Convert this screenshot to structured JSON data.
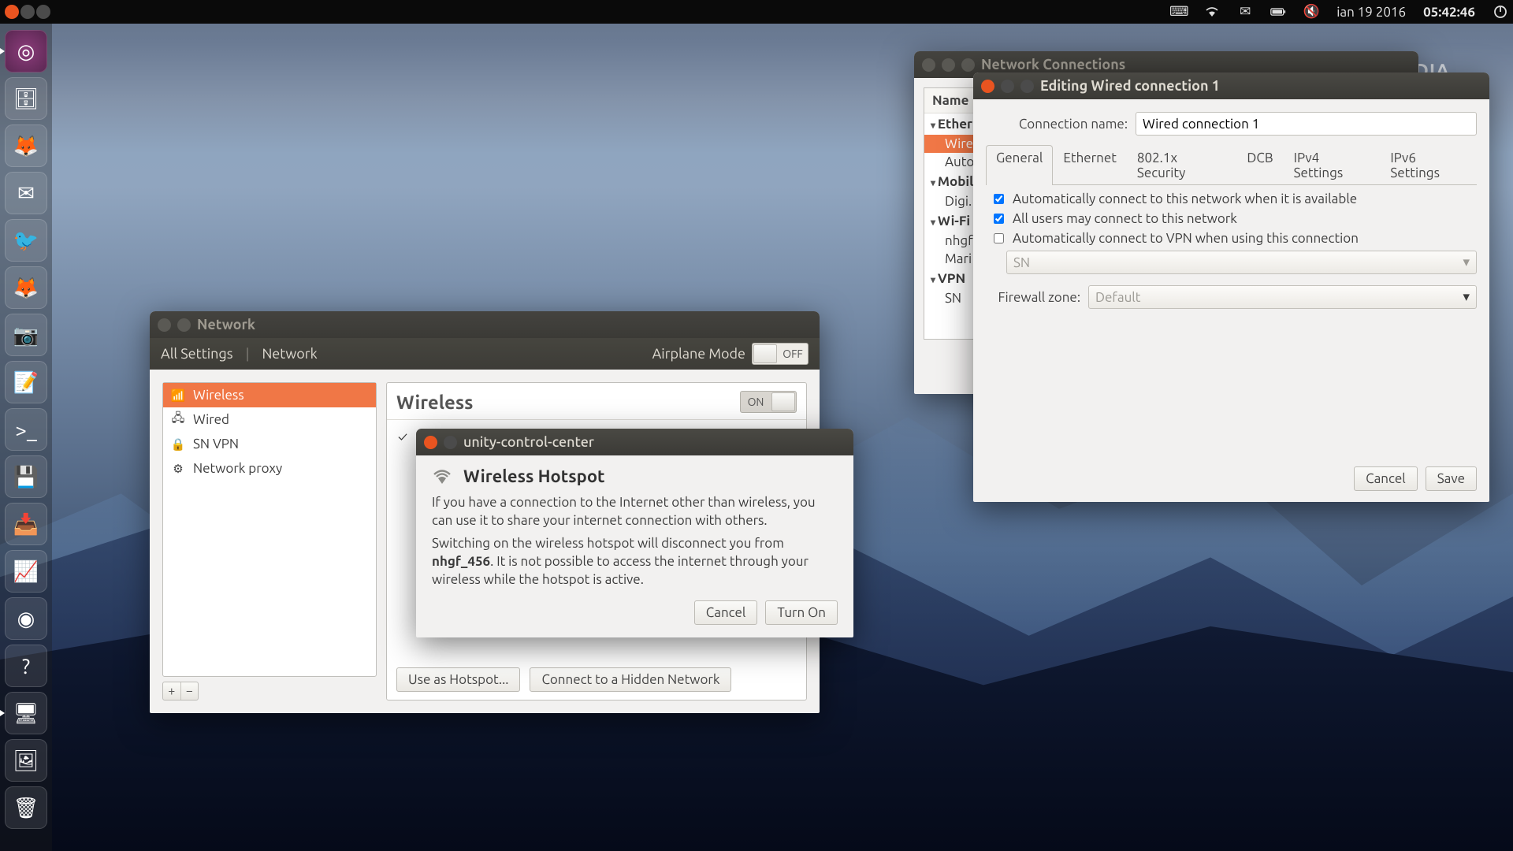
{
  "watermark": "SOFTPEDIA",
  "panel": {
    "date": "ian 19 2016",
    "time": "05:42:46"
  },
  "launcher": [
    {
      "name": "dash",
      "glyph": "◎"
    },
    {
      "name": "files",
      "glyph": "🗄"
    },
    {
      "name": "firefox",
      "glyph": "🦊"
    },
    {
      "name": "thunderbird",
      "glyph": "✉"
    },
    {
      "name": "corebird",
      "glyph": "🐦"
    },
    {
      "name": "gimp",
      "glyph": "🦊"
    },
    {
      "name": "shotwell",
      "glyph": "📷"
    },
    {
      "name": "gedit",
      "glyph": "📝"
    },
    {
      "name": "terminal",
      "glyph": ">_"
    },
    {
      "name": "usb-creator",
      "glyph": "💾"
    },
    {
      "name": "downloads",
      "glyph": "📥"
    },
    {
      "name": "system-monitor",
      "glyph": "📈"
    },
    {
      "name": "steam",
      "glyph": "◉"
    },
    {
      "name": "help",
      "glyph": "?"
    },
    {
      "name": "displays",
      "glyph": "🖥"
    },
    {
      "name": "screenshot",
      "glyph": "🖼"
    },
    {
      "name": "trash",
      "glyph": "🗑"
    }
  ],
  "network_window": {
    "title": "Network",
    "breadcrumb": {
      "all": "All Settings",
      "current": "Network"
    },
    "airplane_label": "Airplane Mode",
    "airplane_state": "OFF",
    "sidebar": [
      {
        "icon": "wifi",
        "label": "Wireless",
        "selected": true
      },
      {
        "icon": "wired",
        "label": "Wired"
      },
      {
        "icon": "vpn",
        "label": "SN VPN"
      },
      {
        "icon": "proxy",
        "label": "Network proxy"
      }
    ],
    "main": {
      "heading": "Wireless",
      "toggle": "ON",
      "buttons": {
        "hotspot": "Use as Hotspot...",
        "hidden": "Connect to a Hidden Network"
      }
    }
  },
  "hotspot_dialog": {
    "title": "unity-control-center",
    "heading": "Wireless Hotspot",
    "para1": "If you have a connection to the Internet other than wireless, you can use it to share your internet connection with others.",
    "para2a": "Switching on the wireless hotspot will disconnect you from ",
    "ssid": "nhgf_456",
    "para2b": ". It is not possible to access the internet through your wireless while the hotspot is active.",
    "cancel": "Cancel",
    "turn_on": "Turn On"
  },
  "conn_window": {
    "title": "Network Connections",
    "header": "Name",
    "items": [
      {
        "type": "cat",
        "label": "Ethernet"
      },
      {
        "type": "row",
        "label": "Wire",
        "selected": true
      },
      {
        "type": "row",
        "label": "Auto"
      },
      {
        "type": "cat",
        "label": "Mobil"
      },
      {
        "type": "row",
        "label": "Digi."
      },
      {
        "type": "cat",
        "label": "Wi-Fi"
      },
      {
        "type": "row",
        "label": "nhgf"
      },
      {
        "type": "row",
        "label": "Mari"
      },
      {
        "type": "cat",
        "label": "VPN"
      },
      {
        "type": "row",
        "label": "SN"
      }
    ]
  },
  "edit_window": {
    "title": "Editing Wired connection 1",
    "name_label": "Connection name:",
    "name_value": "Wired connection 1",
    "tabs": [
      "General",
      "Ethernet",
      "802.1x Security",
      "DCB",
      "IPv4 Settings",
      "IPv6 Settings"
    ],
    "check1": "Automatically connect to this network when it is available",
    "check2": "All users may connect to this network",
    "check3": "Automatically connect to VPN when using this connection",
    "vpn_value": "SN",
    "firewall_label": "Firewall zone:",
    "firewall_value": "Default",
    "cancel": "Cancel",
    "save": "Save"
  }
}
